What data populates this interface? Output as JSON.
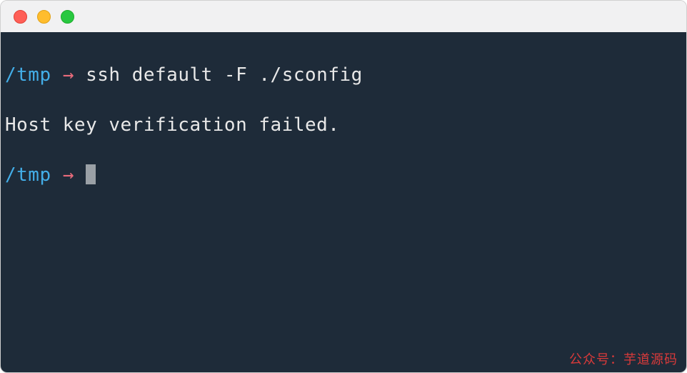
{
  "titlebar": {
    "close": "close",
    "minimize": "minimize",
    "maximize": "maximize"
  },
  "prompt": {
    "path": "/tmp",
    "arrow": "→"
  },
  "lines": {
    "cmd1": "ssh default -F ./sconfig",
    "out1": "Host key verification failed."
  },
  "watermark": "公众号：芋道源码"
}
